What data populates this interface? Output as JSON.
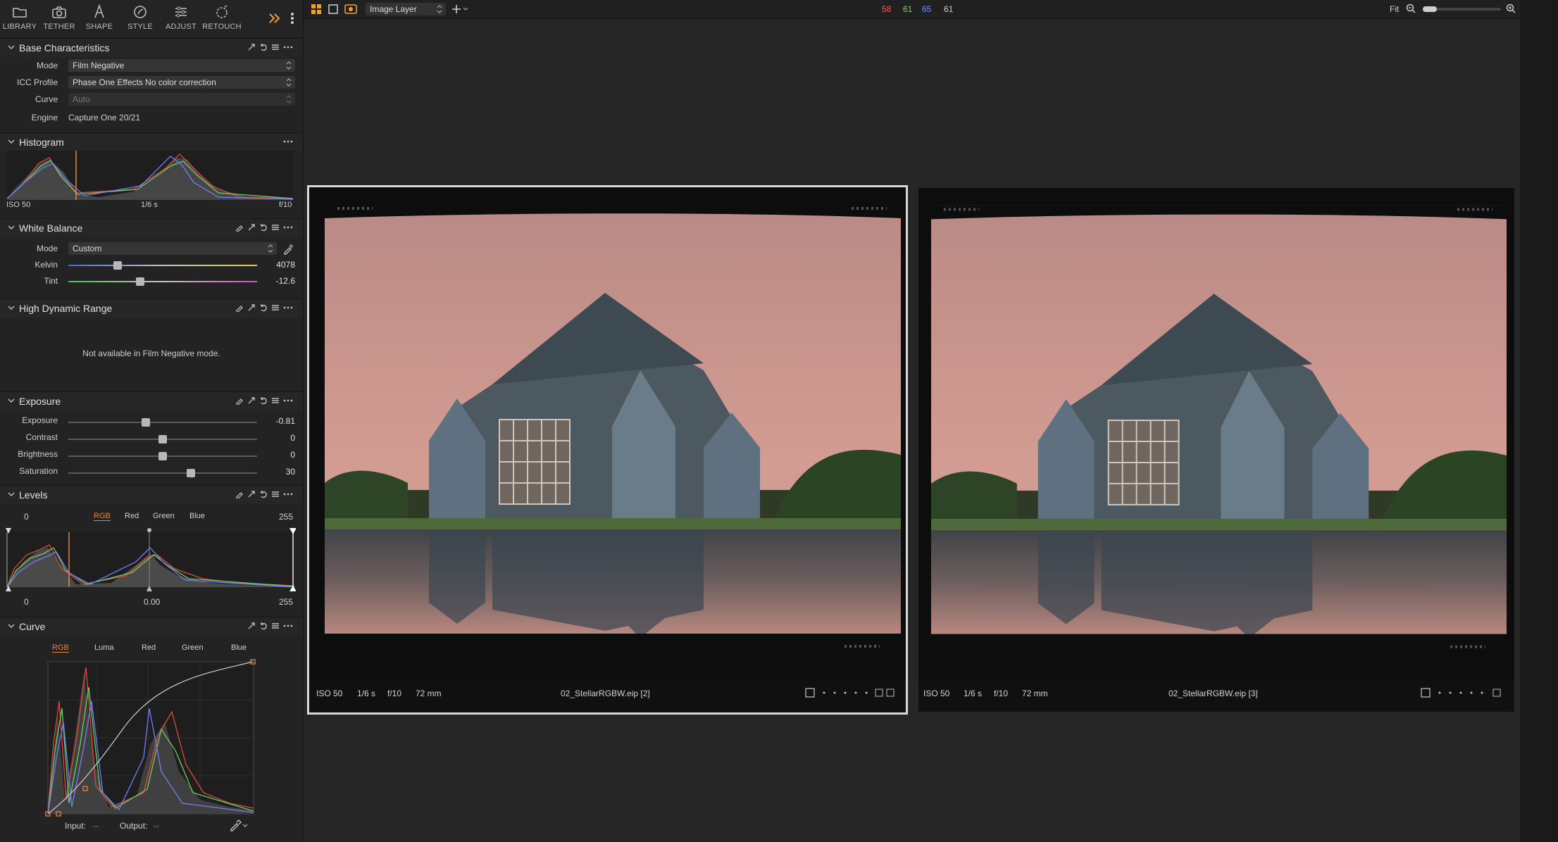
{
  "toolbar": {
    "tabs": [
      {
        "label": "LIBRARY",
        "icon": "folder-icon"
      },
      {
        "label": "TETHER",
        "icon": "camera-icon"
      },
      {
        "label": "SHAPE",
        "icon": "shape-icon"
      },
      {
        "label": "STYLE",
        "icon": "style-icon"
      },
      {
        "label": "ADJUST",
        "icon": "sliders-icon"
      },
      {
        "label": "RETOUCH",
        "icon": "retouch-icon"
      }
    ]
  },
  "base": {
    "title": "Base Characteristics",
    "mode_label": "Mode",
    "mode_value": "Film Negative",
    "icc_label": "ICC Profile",
    "icc_value": "Phase One Effects  No color correction",
    "curve_label": "Curve",
    "curve_value": "Auto",
    "engine_label": "Engine",
    "engine_value": "Capture One 20/21"
  },
  "histogram": {
    "title": "Histogram",
    "iso": "ISO 50",
    "shutter": "1/6 s",
    "aperture": "f/10"
  },
  "white_balance": {
    "title": "White Balance",
    "mode_label": "Mode",
    "mode_value": "Custom",
    "kelvin_label": "Kelvin",
    "kelvin_value": "4078",
    "kelvin_level": 0.26,
    "tint_label": "Tint",
    "tint_value": "-12.6",
    "tint_level": 0.38
  },
  "hdr": {
    "title": "High Dynamic Range",
    "message": "Not available in Film Negative mode."
  },
  "exposure": {
    "title": "Exposure",
    "rows": [
      {
        "label": "Exposure",
        "value": "-0.81",
        "level": 0.41
      },
      {
        "label": "Contrast",
        "value": "0",
        "level": 0.5
      },
      {
        "label": "Brightness",
        "value": "0",
        "level": 0.5
      },
      {
        "label": "Saturation",
        "value": "30",
        "level": 0.65
      }
    ]
  },
  "levels": {
    "title": "Levels",
    "left_input": "0",
    "right_input": "255",
    "tabs": [
      "RGB",
      "Red",
      "Green",
      "Blue"
    ],
    "out_left": "0",
    "out_mid": "0.00",
    "out_right": "255"
  },
  "curve": {
    "title": "Curve",
    "tabs": [
      "RGB",
      "Luma",
      "Red",
      "Green",
      "Blue"
    ],
    "input_label": "Input:",
    "input_value": "--",
    "output_label": "Output:",
    "output_value": "--"
  },
  "topbar": {
    "layer": "Image Layer",
    "r": "58",
    "g": "61",
    "b": "65",
    "l": "61",
    "fit": "Fit",
    "colors": {
      "r": "#ff5a4a",
      "g": "#7fd36b",
      "b": "#6f8fff",
      "accent": "#f0a030"
    }
  },
  "viewer": {
    "left": {
      "iso": "ISO 50",
      "shutter": "1/6 s",
      "aperture": "f/10",
      "focal": "72 mm",
      "filename": "02_StellarRGBW.eip [2]"
    },
    "right": {
      "iso": "ISO 50",
      "shutter": "1/6 s",
      "aperture": "f/10",
      "focal": "72 mm",
      "filename": "02_StellarRGBW.eip [3]"
    }
  }
}
